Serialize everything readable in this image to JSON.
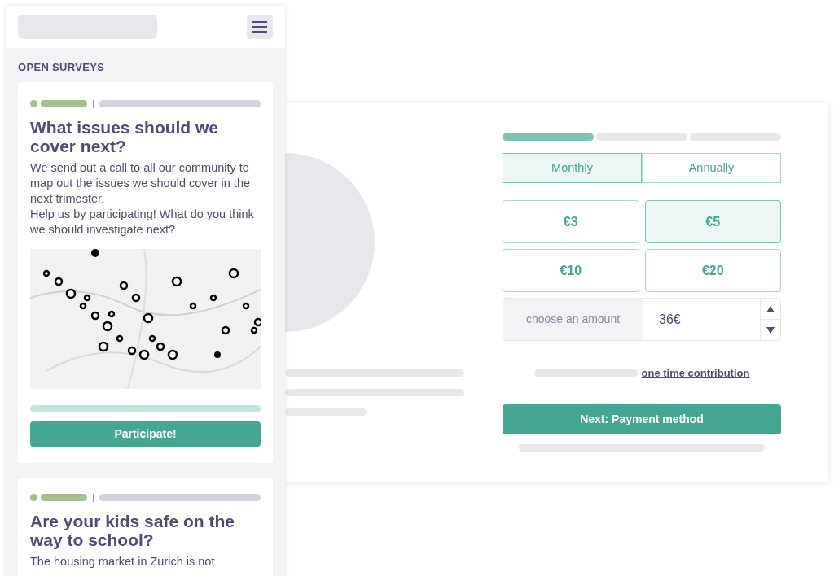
{
  "mobile": {
    "section_title": "OPEN SURVEYS",
    "surveys": [
      {
        "title": "What issues should we cover next?",
        "paragraphs": [
          "We send out a call to all our community to map out the issues we should cover in the next trimester.",
          "Help us by participating! What do you think we should investigate next?"
        ],
        "picture": {
          "kind": "picture"
        },
        "button": "Participate!"
      },
      {
        "title": "Are your kids safe on the way to school?",
        "paragraphs": [
          "The housing market in Zurich is not"
        ]
      }
    ]
  },
  "donation": {
    "steps": [
      {
        "done": true
      },
      {
        "done": false
      },
      {
        "done": false
      }
    ],
    "frequency": [
      {
        "label": "Monthly",
        "selected": true
      },
      {
        "label": "Annually",
        "selected": false
      }
    ],
    "amounts": [
      {
        "label": "€3",
        "selected": false
      },
      {
        "label": "€5",
        "selected": true
      },
      {
        "label": "€10",
        "selected": false
      },
      {
        "label": "€20",
        "selected": false
      }
    ],
    "custom_amount": {
      "label": "choose an amount",
      "value": "36€"
    },
    "link": "one time contribution",
    "next_button": "Next: Payment method"
  }
}
